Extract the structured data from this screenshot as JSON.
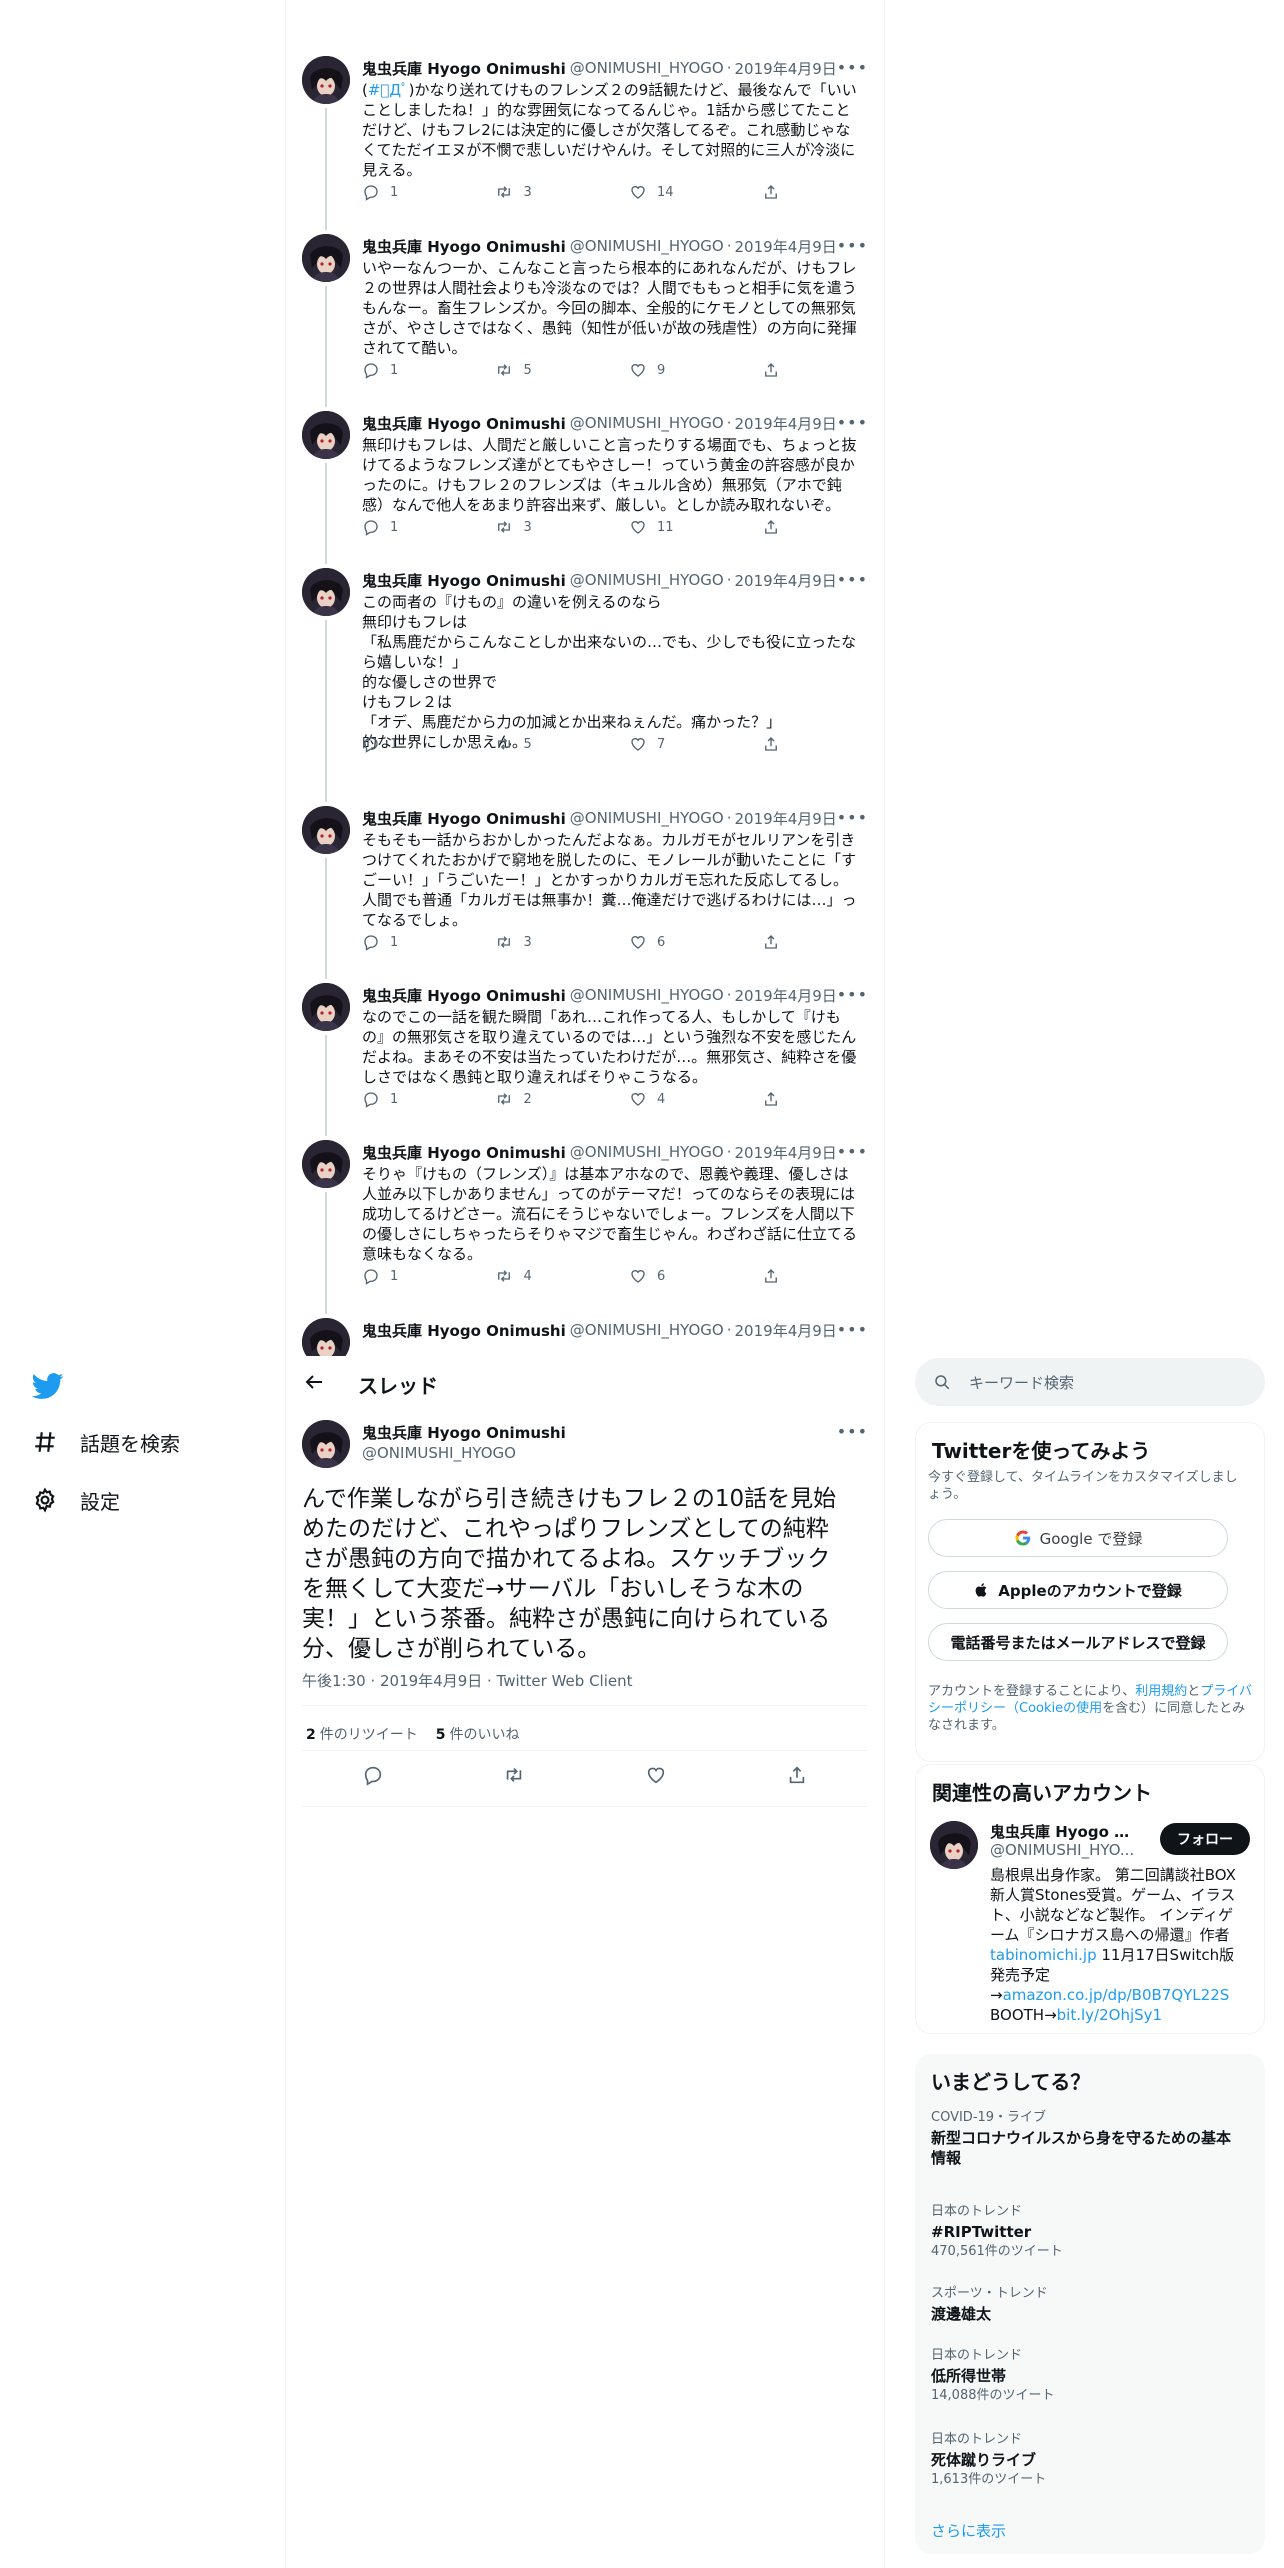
{
  "nav": {
    "search_label": "話題を検索",
    "settings_label": "設定"
  },
  "tweets": [
    {
      "name": "鬼虫兵庫 Hyogo Onimushi",
      "handle": "@ONIMUSHI_HYOGO",
      "date": "2019年4月9日",
      "pre": "(",
      "hashtag": "#ﾟДﾟ",
      "body": ")かなり送れてけものフレンズ２の9話観たけど、最後なんで「いいことしましたね！」的な雰囲気になってるんじゃ。1話から感じてたことだけど、けもフレ2には決定的に優しさが欠落してるぞ。これ感動じゃなくてただイエヌが不憫で悲しいだけやんけ。そして対照的に三人が冷淡に見える。",
      "replies": "1",
      "retweets": "3",
      "likes": "14"
    },
    {
      "name": "鬼虫兵庫 Hyogo Onimushi",
      "handle": "@ONIMUSHI_HYOGO",
      "date": "2019年4月9日",
      "body": "いやーなんつーか、こんなこと言ったら根本的にあれなんだが、けもフレ２の世界は人間社会よりも冷淡なのでは？人間でももっと相手に気を遣うもんなー。畜生フレンズか。今回の脚本、全般的にケモノとしての無邪気さが、やさしさではなく、愚鈍（知性が低いが故の残虐性）の方向に発揮されてて酷い。",
      "replies": "1",
      "retweets": "5",
      "likes": "9"
    },
    {
      "name": "鬼虫兵庫 Hyogo Onimushi",
      "handle": "@ONIMUSHI_HYOGO",
      "date": "2019年4月9日",
      "body": "無印けもフレは、人間だと厳しいこと言ったりする場面でも、ちょっと抜けてるようなフレンズ達がとてもやさしー！っていう黄金の許容感が良かったのに。けもフレ２のフレンズは（キュルル含め）無邪気（アホで鈍感）なんで他人をあまり許容出来ず、厳しい。としか読み取れないぞ。",
      "replies": "1",
      "retweets": "3",
      "likes": "11"
    },
    {
      "name": "鬼虫兵庫 Hyogo Onimushi",
      "handle": "@ONIMUSHI_HYOGO",
      "date": "2019年4月9日",
      "body": "この両者の『けもの』の違いを例えるのなら\n無印けもフレは\n「私馬鹿だからこんなことしか出来ないの…でも、少しでも役に立ったなら嬉しいな！」\n的な優しさの世界で\nけもフレ２は\n「オデ、馬鹿だから力の加減とか出来ねぇんだ。痛かった？」\n的な世界にしか思えん。",
      "replies": "1",
      "retweets": "5",
      "likes": "7"
    },
    {
      "name": "鬼虫兵庫 Hyogo Onimushi",
      "handle": "@ONIMUSHI_HYOGO",
      "date": "2019年4月9日",
      "body": "そもそも一話からおかしかったんだよなぁ。カルガモがセルリアンを引きつけてくれたおかげで窮地を脱したのに、モノレールが動いたことに「すごーい！」「うごいたー！」とかすっかりカルガモ忘れた反応してるし。人間でも普通「カルガモは無事か！糞…俺達だけで逃げるわけには…」ってなるでしょ。",
      "replies": "1",
      "retweets": "3",
      "likes": "6"
    },
    {
      "name": "鬼虫兵庫 Hyogo Onimushi",
      "handle": "@ONIMUSHI_HYOGO",
      "date": "2019年4月9日",
      "body": "なのでこの一話を観た瞬間「あれ…これ作ってる人、もしかして『けもの』の無邪気さを取り違えているのでは…」という強烈な不安を感じたんだよね。まあその不安は当たっていたわけだが…。無邪気さ、純粋さを優しさではなく愚鈍と取り違えればそりゃこうなる。",
      "replies": "1",
      "retweets": "2",
      "likes": "4"
    },
    {
      "name": "鬼虫兵庫 Hyogo Onimushi",
      "handle": "@ONIMUSHI_HYOGO",
      "date": "2019年4月9日",
      "body": "そりゃ『けもの（フレンズ）』は基本アホなので、恩義や義理、優しさは人並み以下しかありません」ってのがテーマだ！ってのならその表現には成功してるけどさー。流石にそうじゃないでしょー。フレンズを人間以下の優しさにしちゃったらそりゃマジで畜生じゃん。わざわざ話に仕立てる意味もなくなる。",
      "replies": "1",
      "retweets": "4",
      "likes": "6"
    },
    {
      "name": "鬼虫兵庫 Hyogo Onimushi",
      "handle": "@ONIMUSHI_HYOGO",
      "date": "2019年4月9日",
      "body": "",
      "replies": "",
      "retweets": "",
      "likes": ""
    }
  ],
  "thread": {
    "title": "スレッド",
    "name": "鬼虫兵庫 Hyogo Onimushi",
    "handle": "@ONIMUSHI_HYOGO",
    "body": "んで作業しながら引き続きけもフレ２の10話を見始めたのだけど、これやっぱりフレンズとしての純粋さが愚鈍の方向で描かれてるよね。スケッチブックを無くして大変だ→サーバル「おいしそうな木の実！」という茶番。純粋さが愚鈍に向けられている分、優しさが削られている。",
    "meta": "午後1:30 · 2019年4月9日 · Twitter Web Client",
    "retweet_count": "2",
    "retweet_label": "件のリツイート",
    "like_count": "5",
    "like_label": "件のいいね"
  },
  "search": {
    "placeholder": "キーワード検索"
  },
  "signup": {
    "title": "Twitterを使ってみよう",
    "desc": "今すぐ登録して、タイムラインをカスタマイズしましょう。",
    "google_label": "Google で登録",
    "apple_label": "Appleのアカウントで登録",
    "phone_label": "電話番号またはメールアドレスで登録",
    "legal_1": "アカウントを登録することにより、",
    "legal_link1": "利用規約",
    "legal_2": "と",
    "legal_link2": "プライバシーポリシー（Cookieの使用",
    "legal_3": "を含む）に同意したとみなされます。"
  },
  "related": {
    "title": "関連性の高いアカウント",
    "name": "鬼虫兵庫 Hyogo Oni...",
    "handle": "@ONIMUSHI_HYO...",
    "follow_label": "フォロー",
    "bio_1": "島根県出身作家。 第二回講談社BOX新人賞Stones受賞。ゲーム、イラスト、小説などなど製作。 インディゲーム『シロナガス島への帰還』作者 ",
    "bio_link1": "tabinomichi.jp",
    "bio_2": " 11月17日Switch版発売予定\n→",
    "bio_link2": "amazon.co.jp/dp/B0B7QYL22S",
    "bio_3": "\nBOOTH→",
    "bio_link3": "bit.ly/2OhjSy1"
  },
  "trends": {
    "title": "いまどうしてる？",
    "items": [
      {
        "meta": "COVID-19・ライブ",
        "name": "新型コロナウイルスから身を守るための基本情報",
        "count": ""
      },
      {
        "meta": "日本のトレンド",
        "name": "#RIPTwitter",
        "count": "470,561件のツイート"
      },
      {
        "meta": "スポーツ・トレンド",
        "name": "渡邊雄太",
        "count": ""
      },
      {
        "meta": "日本のトレンド",
        "name": "低所得世帯",
        "count": "14,088件のツイート"
      },
      {
        "meta": "日本のトレンド",
        "name": "死体蹴りライブ",
        "count": "1,613件のツイート"
      }
    ],
    "show_more": "さらに表示"
  },
  "colors": {
    "accent": "#1d9bf0",
    "text": "#0f1419",
    "muted": "#536471",
    "border": "#eff3f4"
  }
}
